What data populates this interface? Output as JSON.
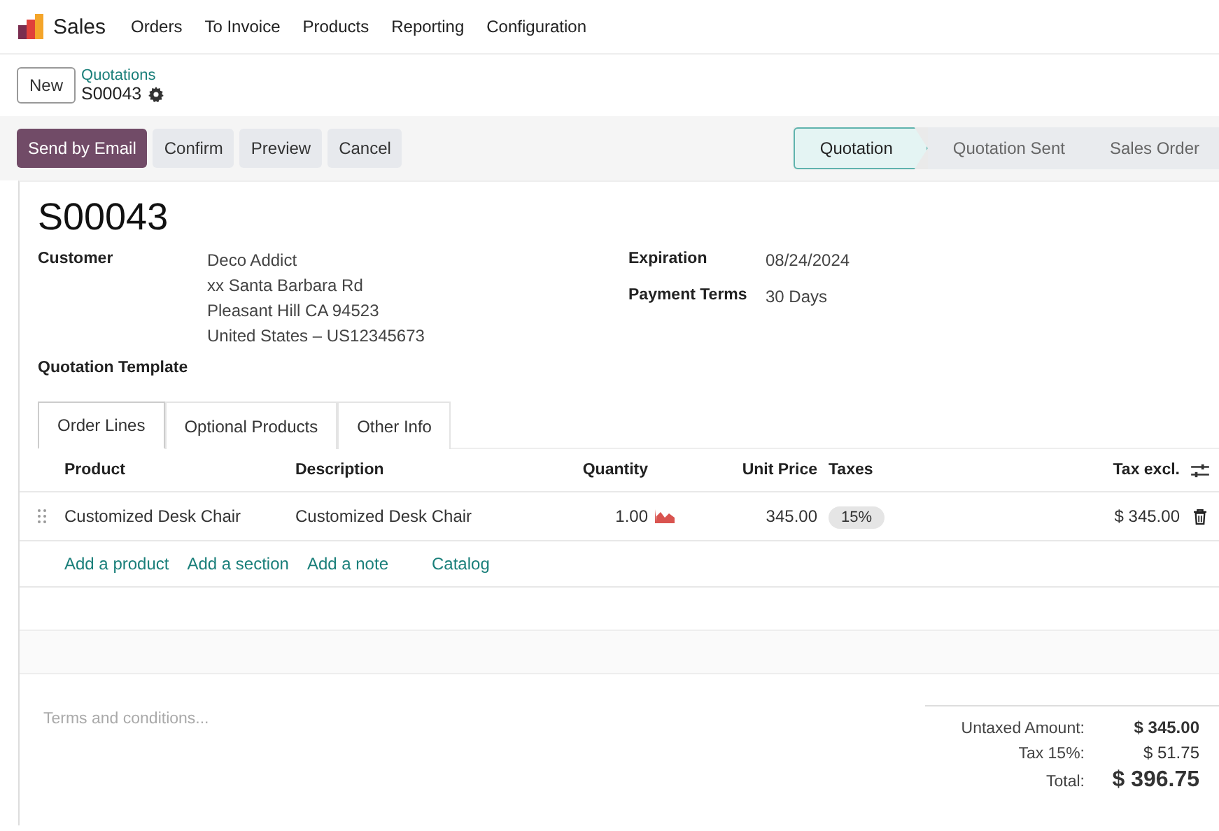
{
  "navbar": {
    "app_name": "Sales",
    "menu": [
      "Orders",
      "To Invoice",
      "Products",
      "Reporting",
      "Configuration"
    ]
  },
  "control_panel": {
    "new_button": "New",
    "breadcrumb": "Quotations",
    "record": "S00043"
  },
  "actions": [
    {
      "label": "Send by Email",
      "kind": "primary"
    },
    {
      "label": "Confirm",
      "kind": "secondary"
    },
    {
      "label": "Preview",
      "kind": "secondary"
    },
    {
      "label": "Cancel",
      "kind": "secondary"
    }
  ],
  "statusbar": [
    {
      "label": "Quotation",
      "selected": true
    },
    {
      "label": "Quotation Sent",
      "selected": false
    },
    {
      "label": "Sales Order",
      "selected": false
    }
  ],
  "form": {
    "title": "S00043",
    "left_fields": [
      {
        "label": "Customer",
        "lines": [
          "Deco Addict",
          "xx Santa Barbara Rd",
          "Pleasant Hill CA 94523",
          "United States – US12345673"
        ]
      },
      {
        "label": "Quotation Template"
      }
    ],
    "right_fields": [
      {
        "label": "Expiration",
        "value": "08/24/2024"
      },
      {
        "label": "Payment Terms",
        "value": "30 Days"
      }
    ]
  },
  "tabs": [
    {
      "label": "Order Lines",
      "selected": true
    },
    {
      "label": "Optional Products",
      "selected": false
    },
    {
      "label": "Other Info",
      "selected": false
    }
  ],
  "table": {
    "columns": [
      "Product",
      "Description",
      "Quantity",
      "Unit Price",
      "Taxes",
      "Tax excl."
    ],
    "rows": [
      {
        "product": "Customized Desk Chair",
        "description": "Customized Desk Chair",
        "quantity": "1.00",
        "unit_price": "345.00",
        "taxes": "15%",
        "tax_excl": "$ 345.00"
      }
    ],
    "add_links": [
      "Add a product",
      "Add a section",
      "Add a note",
      "Catalog"
    ]
  },
  "terms": {
    "placeholder": "Terms and conditions..."
  },
  "totals": [
    {
      "label": "Untaxed Amount:",
      "value": "$ 345.00",
      "kind": "subtotal"
    },
    {
      "label": "Tax 15%:",
      "value": "$ 51.75",
      "kind": "tax"
    },
    {
      "label": "Total:",
      "value": "$ 396.75",
      "kind": "total"
    }
  ]
}
